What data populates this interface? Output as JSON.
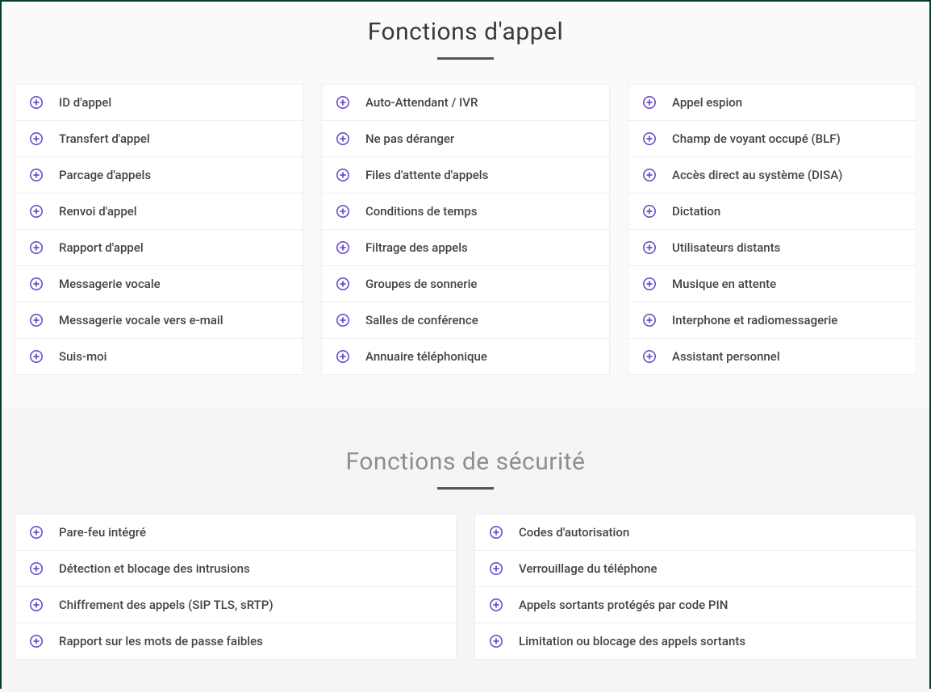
{
  "sections": {
    "call": {
      "title": "Fonctions d'appel",
      "columns": [
        [
          "ID d'appel",
          "Transfert d'appel",
          "Parcage d'appels",
          "Renvoi d'appel",
          "Rapport d'appel",
          "Messagerie vocale",
          "Messagerie vocale vers e-mail",
          "Suis-moi"
        ],
        [
          "Auto-Attendant / IVR",
          "Ne pas déranger",
          "Files d'attente d'appels",
          "Conditions de temps",
          "Filtrage des appels",
          "Groupes de sonnerie",
          "Salles de conférence",
          "Annuaire téléphonique"
        ],
        [
          "Appel espion",
          "Champ de voyant occupé (BLF)",
          "Accès direct au système (DISA)",
          "Dictation",
          "Utilisateurs distants",
          "Musique en attente",
          "Interphone et radiomessagerie",
          "Assistant personnel"
        ]
      ]
    },
    "security": {
      "title": "Fonctions de sécurité",
      "columns": [
        [
          "Pare-feu intégré",
          "Détection et blocage des intrusions",
          "Chiffrement des appels (SIP TLS, sRTP)",
          "Rapport sur les mots de passe faibles"
        ],
        [
          "Codes d'autorisation",
          "Verrouillage du téléphone",
          "Appels sortants protégés par code PIN",
          "Limitation ou blocage des appels sortants"
        ]
      ]
    }
  }
}
